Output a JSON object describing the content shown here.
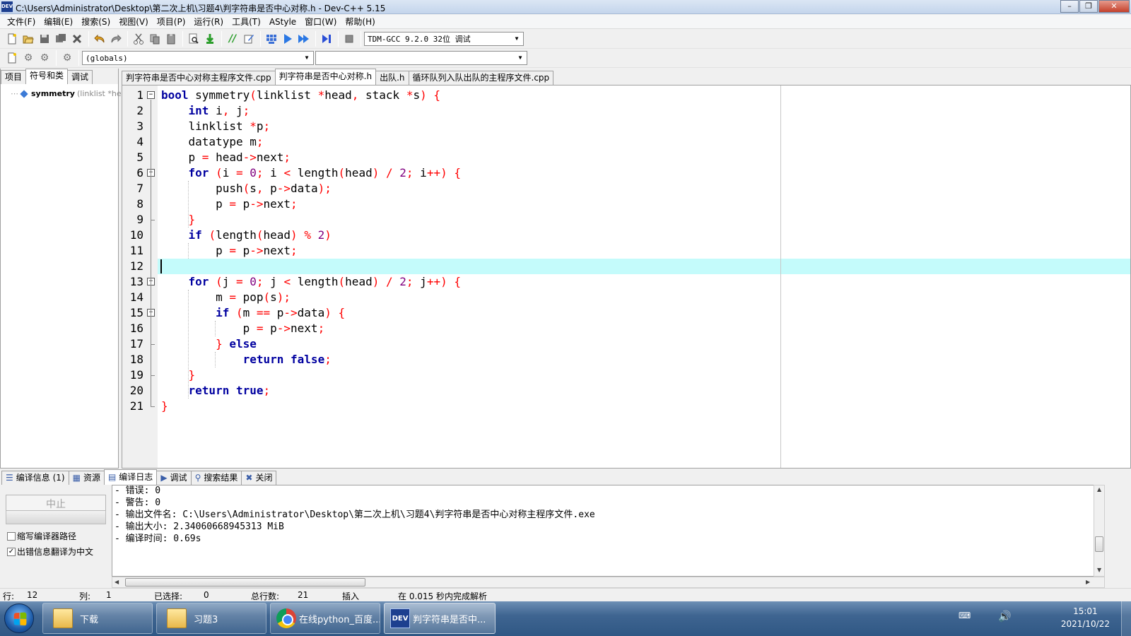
{
  "window": {
    "title": "C:\\Users\\Administrator\\Desktop\\第二次上机\\习题4\\判字符串是否中心对称.h - Dev-C++ 5.15",
    "app_icon_text": "DEV"
  },
  "menu": [
    "文件(F)",
    "编辑(E)",
    "搜索(S)",
    "视图(V)",
    "项目(P)",
    "运行(R)",
    "工具(T)",
    "AStyle",
    "窗口(W)",
    "帮助(H)"
  ],
  "toolbar": {
    "compiler_select": "TDM-GCC 9.2.0 32位  调试",
    "scope_select": "(globals)",
    "member_select": ""
  },
  "left_panel": {
    "tabs": [
      "项目",
      "符号和类",
      "调试"
    ],
    "active_tab": "符号和类",
    "tree_item_name": "symmetry",
    "tree_item_sig": "(linklist *head,"
  },
  "editor": {
    "tabs": [
      "判字符串是否中心对称主程序文件.cpp",
      "判字符串是否中心对称.h",
      "出队.h",
      "循环队列入队出队的主程序文件.cpp"
    ],
    "active_tab": "判字符串是否中心对称.h",
    "current_line": 12,
    "line_numbers": [
      "1",
      "2",
      "3",
      "4",
      "5",
      "6",
      "7",
      "8",
      "9",
      "10",
      "11",
      "12",
      "13",
      "14",
      "15",
      "16",
      "17",
      "18",
      "19",
      "20",
      "21"
    ],
    "code": [
      "bool symmetry(linklist *head, stack *s) {",
      "    int i, j;",
      "    linklist *p;",
      "    datatype m;",
      "    p = head->next;",
      "    for (i = 0; i < length(head) / 2; i++) {",
      "        push(s, p->data);",
      "        p = p->next;",
      "    }",
      "    if (length(head) % 2)",
      "        p = p->next;",
      "",
      "    for (j = 0; j < length(head) / 2; j++) {",
      "        m = pop(s);",
      "        if (m == p->data) {",
      "            p = p->next;",
      "        } else",
      "            return false;",
      "    }",
      "    return true;",
      "}"
    ]
  },
  "bottom_tabs": [
    {
      "label": "编译信息 (1)",
      "icon": "compile-info-icon"
    },
    {
      "label": "资源",
      "icon": "resources-icon"
    },
    {
      "label": "编译日志",
      "icon": "compile-log-icon"
    },
    {
      "label": "调试",
      "icon": "debug-icon"
    },
    {
      "label": "搜索结果",
      "icon": "search-results-icon"
    },
    {
      "label": "关闭",
      "icon": "close-icon"
    }
  ],
  "bottom_panel": {
    "stop_button": "中止",
    "checkbox_short_path": "缩写编译器路径",
    "checkbox_short_path_checked": false,
    "checkbox_translate": "出错信息翻译为中文",
    "checkbox_translate_checked": true,
    "log_lines": [
      "- 错误: 0",
      "- 警告: 0",
      "- 输出文件名: C:\\Users\\Administrator\\Desktop\\第二次上机\\习题4\\判字符串是否中心对称主程序文件.exe",
      "- 输出大小: 2.34060668945313 MiB",
      "- 编译时间: 0.69s"
    ]
  },
  "status": {
    "row_label": "行:",
    "row_value": "12",
    "col_label": "列:",
    "col_value": "1",
    "sel_label": "已选择:",
    "sel_value": "0",
    "total_label": "总行数:",
    "total_value": "21",
    "mode": "插入",
    "parse": "在 0.015 秒内完成解析"
  },
  "taskbar": {
    "items": [
      "下载",
      "习题3",
      "在线python_百度...",
      "判字符串是否中..."
    ],
    "active_index": 3,
    "time": "15:01",
    "date": "2021/10/22"
  }
}
